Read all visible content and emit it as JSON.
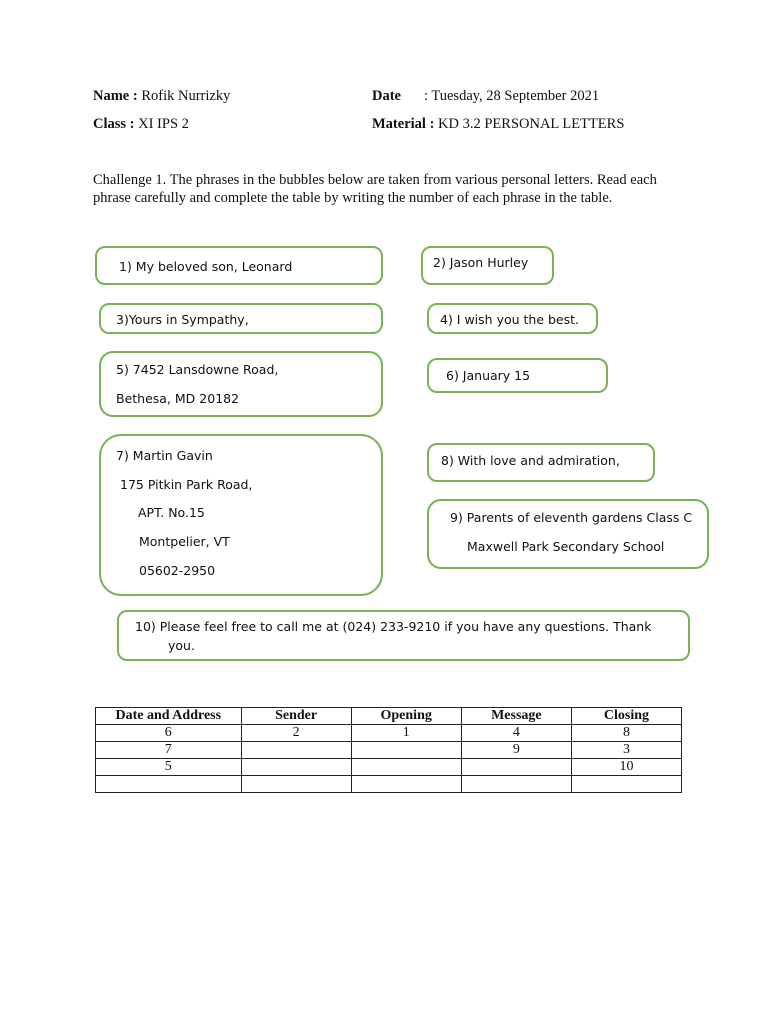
{
  "header": {
    "name_label": "Name :",
    "name_value": "Rofik Nurrizky",
    "date_label": "Date",
    "date_value": ": Tuesday, 28 September 2021",
    "class_label": "Class :",
    "class_value": "XI IPS 2",
    "material_label": "Material :",
    "material_value": "KD 3.2 PERSONAL LETTERS"
  },
  "instruction": "Challenge 1.  The phrases in the bubbles below are taken from various personal letters. Read each phrase carefully and complete the table by writing the number of each phrase in the table.",
  "bubbles": [
    {
      "lines": [
        "1)  My beloved son, Leonard"
      ]
    },
    {
      "lines": [
        "2)  Jason Hurley"
      ]
    },
    {
      "lines": [
        "3)Yours in Sympathy,"
      ]
    },
    {
      "lines": [
        "4)  I wish you the best."
      ]
    },
    {
      "lines": [
        "5)   7452 Lansdowne Road,",
        "Bethesa, MD 20182"
      ]
    },
    {
      "lines": [
        "6)  January 15"
      ]
    },
    {
      "lines": [
        "7)   Martin Gavin",
        "175 Pitkin Park Road,",
        "APT. No.15",
        "Montpelier, VT",
        "05602-2950"
      ]
    },
    {
      "lines": [
        "8) With love and admiration,"
      ]
    },
    {
      "lines": [
        "9) Parents of eleventh gardens Class C",
        "Maxwell Park Secondary School"
      ]
    },
    {
      "lines": [
        "10) Please feel free to call me at (024) 233-9210 if you have any questions. Thank",
        "you."
      ]
    }
  ],
  "table": {
    "headers": [
      "Date and Address",
      "Sender",
      "Opening",
      "Message",
      "Closing"
    ],
    "rows": [
      [
        "6",
        "2",
        "1",
        "4",
        "8"
      ],
      [
        "7",
        "",
        "",
        "9",
        "3"
      ],
      [
        "5",
        "",
        "",
        "",
        "10"
      ],
      [
        "",
        "",
        "",
        "",
        ""
      ]
    ]
  }
}
